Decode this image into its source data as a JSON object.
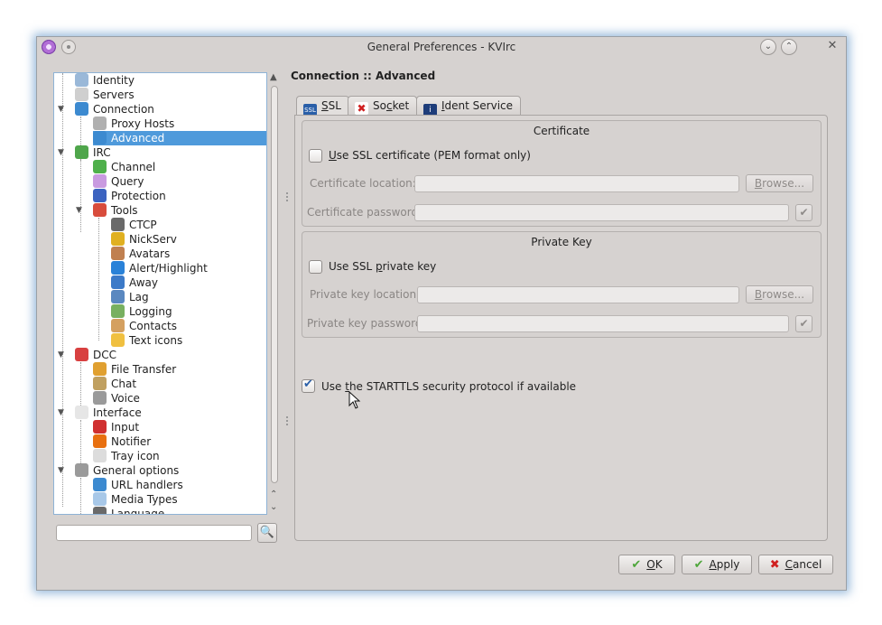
{
  "window": {
    "title": "General Preferences - KVIrc"
  },
  "tree": {
    "items": [
      {
        "label": "Identity",
        "icon": "identity-icon",
        "color": "#9ab8d8"
      },
      {
        "label": "Servers",
        "icon": "servers-icon",
        "color": "#cfcfcf"
      },
      {
        "label": "Connection",
        "icon": "connection-icon",
        "color": "#3c8ad0"
      },
      {
        "label": "Proxy Hosts",
        "icon": "proxy-hosts-icon",
        "color": "#b0b0b0"
      },
      {
        "label": "Advanced",
        "icon": "advanced-icon",
        "color": "#3c8ad0"
      },
      {
        "label": "IRC",
        "icon": "irc-icon",
        "color": "#4fa64b"
      },
      {
        "label": "Channel",
        "icon": "channel-icon",
        "color": "#4fb04b"
      },
      {
        "label": "Query",
        "icon": "query-icon",
        "color": "#c99ae0"
      },
      {
        "label": "Protection",
        "icon": "protection-icon",
        "color": "#3c63c0"
      },
      {
        "label": "Tools",
        "icon": "tools-icon",
        "color": "#d84c3c"
      },
      {
        "label": "CTCP",
        "icon": "ctcp-icon",
        "color": "#6a6a6a"
      },
      {
        "label": "NickServ",
        "icon": "nickserv-icon",
        "color": "#e0b020"
      },
      {
        "label": "Avatars",
        "icon": "avatars-icon",
        "color": "#c08050"
      },
      {
        "label": "Alert/Highlight",
        "icon": "alert-highlight-icon",
        "color": "#2a82d8"
      },
      {
        "label": "Away",
        "icon": "away-icon",
        "color": "#3c7ac8"
      },
      {
        "label": "Lag",
        "icon": "lag-icon",
        "color": "#5a88c0"
      },
      {
        "label": "Logging",
        "icon": "logging-icon",
        "color": "#78b060"
      },
      {
        "label": "Contacts",
        "icon": "contacts-icon",
        "color": "#d4a060"
      },
      {
        "label": "Text icons",
        "icon": "text-icons-icon",
        "color": "#f0c040"
      },
      {
        "label": "DCC",
        "icon": "dcc-icon",
        "color": "#d84040"
      },
      {
        "label": "File Transfer",
        "icon": "file-transfer-icon",
        "color": "#e0a030"
      },
      {
        "label": "Chat",
        "icon": "chat-icon",
        "color": "#c0a060"
      },
      {
        "label": "Voice",
        "icon": "voice-icon",
        "color": "#9a9a9a"
      },
      {
        "label": "Interface",
        "icon": "interface-icon",
        "color": "#e6e6e6"
      },
      {
        "label": "Input",
        "icon": "input-icon",
        "color": "#d03030"
      },
      {
        "label": "Notifier",
        "icon": "notifier-icon",
        "color": "#e87010"
      },
      {
        "label": "Tray icon",
        "icon": "tray-icon-icon",
        "color": "#dcdcdc"
      },
      {
        "label": "General options",
        "icon": "general-options-icon",
        "color": "#9a9a9a"
      },
      {
        "label": "URL handlers",
        "icon": "url-handlers-icon",
        "color": "#3c8ad0"
      },
      {
        "label": "Media Types",
        "icon": "media-types-icon",
        "color": "#a8c8e8"
      },
      {
        "label": "Language",
        "icon": "language-icon",
        "color": "#6a6a6a"
      }
    ]
  },
  "main": {
    "page_title": "Connection :: Advanced",
    "tabs": [
      {
        "label": "SSL",
        "underline": "S",
        "rest": "SL"
      },
      {
        "label": "Socket",
        "pre": "So",
        "underline": "c",
        "rest": "ket"
      },
      {
        "label": "Ident Service",
        "underline": "I",
        "rest": "dent Service"
      }
    ],
    "certificate": {
      "title": "Certificate",
      "use_label_u": "U",
      "use_label_rest": "se SSL certificate (PEM format only)",
      "location_label": "Certificate location:",
      "password_label": "Certificate password:",
      "browse_u": "B",
      "browse_rest": "rowse..."
    },
    "private_key": {
      "title": "Private Key",
      "use_label_pre": "Use SSL ",
      "use_label_u": "p",
      "use_label_rest": "rivate key",
      "location_label": "Private key location:",
      "password_label": "Private key password:",
      "browse_u": "B",
      "browse_rest": "rowse..."
    },
    "starttls": {
      "pre": "Use ",
      "u": "t",
      "rest": "he STARTTLS security protocol if available",
      "checked": true
    }
  },
  "buttons": {
    "ok_u": "O",
    "ok_rest": "K",
    "apply_u": "A",
    "apply_rest": "pply",
    "cancel_u": "C",
    "cancel_rest": "ancel"
  },
  "colors": {
    "accent": "#4f9adb",
    "check_green": "#4ea63a",
    "cancel_red": "#d02020"
  }
}
